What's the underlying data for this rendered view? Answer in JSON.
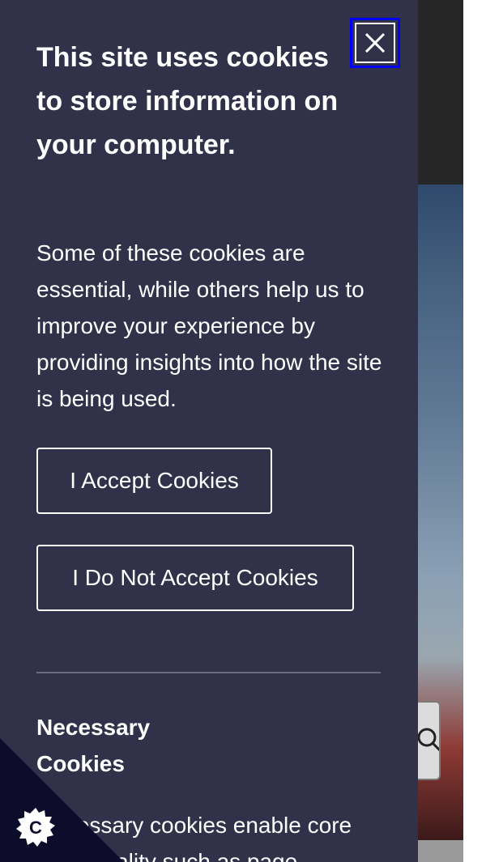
{
  "consent": {
    "close_icon": "close-icon",
    "title": "This site uses cookies to store information on your computer.",
    "intro": "Some of these cookies are essential, while others help us to improve your experience by providing insights into how the site is being used.",
    "accept_label": "I Accept Cookies",
    "decline_label": "I Do Not Accept Cookies",
    "necessary": {
      "title": "Necessary Cookies",
      "text": "Necessary cookies enable core functionality such as page"
    }
  },
  "badge": {
    "icon": "cookie-icon",
    "letter": "C"
  },
  "colors": {
    "panel": "#31314a",
    "focus_outline": "#0000ff",
    "corner": "#0d0d2b"
  }
}
